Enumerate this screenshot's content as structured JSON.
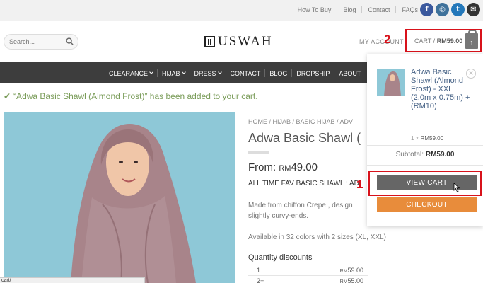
{
  "topbar": {
    "links": [
      "How To Buy",
      "Blog",
      "Contact",
      "FAQs"
    ],
    "social": [
      {
        "icon": "facebook-icon",
        "glyph": "f",
        "color": "#3a589d"
      },
      {
        "icon": "instagram-icon",
        "glyph": "◎",
        "color": "#3f729b"
      },
      {
        "icon": "twitter-icon",
        "glyph": "t",
        "color": "#2478ba"
      },
      {
        "icon": "email-icon",
        "glyph": "✉",
        "color": "#333333"
      }
    ]
  },
  "header": {
    "search_placeholder": "Search...",
    "logo_text": "USWAH",
    "account_label": "MY ACCOUNT",
    "cart_label": "CART /",
    "cart_total": "RM59.00",
    "cart_count": "1",
    "annotation_2": "2"
  },
  "nav": {
    "items": [
      {
        "label": "CLEARANCE",
        "dropdown": true
      },
      {
        "label": "HIJAB",
        "dropdown": true
      },
      {
        "label": "DRESS",
        "dropdown": true
      },
      {
        "label": "CONTACT",
        "dropdown": false
      },
      {
        "label": "BLOG",
        "dropdown": false
      },
      {
        "label": "DROPSHIP",
        "dropdown": false
      },
      {
        "label": "ABOUT",
        "dropdown": false
      }
    ]
  },
  "notice": {
    "text": "“Adwa Basic Shawl (Almond Frost)” has been added to your cart."
  },
  "product": {
    "breadcrumb": "HOME / HIJAB / BASIC HIJAB / ADV",
    "title": "Adwa Basic Shawl (",
    "price_prefix": "From: ",
    "price_currency": "RM",
    "price_value": "49.00",
    "fav_line": "ALL TIME FAV BASIC SHAWL : AD",
    "description": "Made from chiffon Crepe , design slightly curvy-ends.",
    "availability": "Available in 32 colors with 2 sizes (XL, XXL)",
    "quantity_discounts_label": "Quantity discounts",
    "discounts": [
      {
        "qty": "1",
        "currency": "RM",
        "price": "59.00"
      },
      {
        "qty": "2+",
        "currency": "RM",
        "price": "55.00"
      }
    ]
  },
  "cart_dropdown": {
    "item_name": "Adwa Basic Shawl (Almond Frost) - XXL (2.0m x 0.75m) + (RM10)",
    "item_qty": "1 ×",
    "item_price": "RM59.00",
    "remove_glyph": "×",
    "subtotal_label": "Subtotal:",
    "subtotal_value": "RM59.00",
    "view_cart_label": "VIEW CART",
    "checkout_label": "CHECKOUT",
    "annotation_1": "1"
  },
  "statusbar": {
    "text": "cart/"
  },
  "colors": {
    "accent_blue": "#446084",
    "checkout_orange": "#e88c3b",
    "annotation_red": "#d8121b",
    "nav_bg": "#3d3d3d",
    "success_green": "#7a9c59"
  }
}
